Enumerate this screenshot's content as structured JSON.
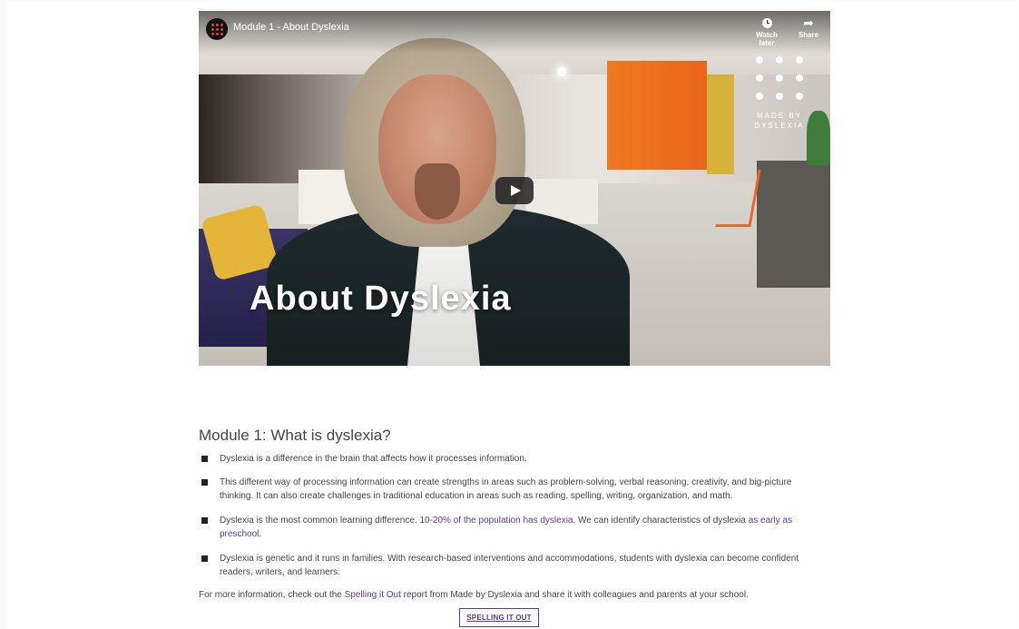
{
  "video": {
    "title": "Module 1 - About Dyslexia",
    "watch_later_label": "Watch later",
    "share_label": "Share",
    "brand_logo_text": "MADE BY DYSLEXIA",
    "overlay_title": "About Dyslexia"
  },
  "module": {
    "heading": "Module 1: What is dyslexia?",
    "bullets": [
      {
        "text": "Dyslexia is a difference in the brain that affects how it processes information."
      },
      {
        "text": "This different way of processing information can create strengths in areas such as problem-solving, verbal reasoning, creativity, and big-picture thinking. It can also create challenges in traditional education in areas such as reading, spelling, writing, organization, and math."
      },
      {
        "text_before": "Dyslexia is the most common learning difference. ",
        "link1": "10-20% of the population has dyslexia",
        "text_middle": ". We can identify characteristics of dyslexia ",
        "link2": "as early as preschool",
        "text_after": "."
      },
      {
        "text": "Dyslexia is genetic and it runs in families. With research-based interventions and accommodations, students with dyslexia can become confident readers, writers, and learners."
      }
    ],
    "more_info": {
      "before": "For more information, check out the ",
      "link": "Spelling it Out",
      "after": " report from Made by Dyslexia and share it with colleagues and parents at your school."
    },
    "button_label": "SPELLING IT OUT"
  },
  "colors": {
    "link": "#5b3a8e",
    "text": "#444444"
  }
}
